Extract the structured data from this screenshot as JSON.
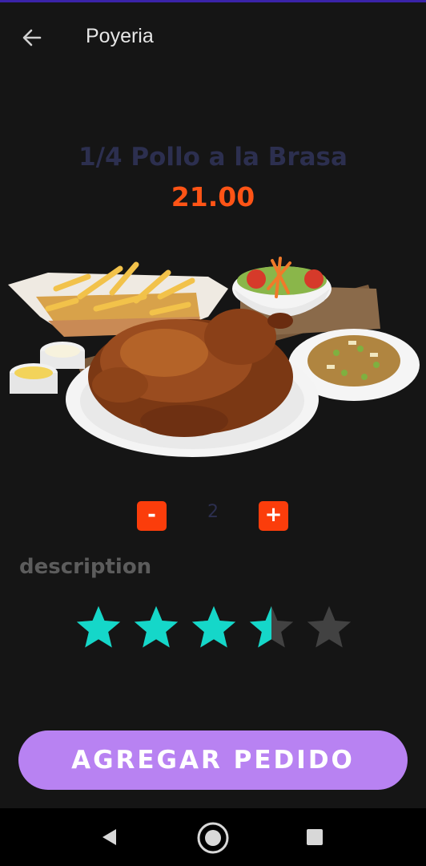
{
  "app_bar": {
    "title": "Poyeria",
    "back_icon": "arrow-left-icon"
  },
  "product": {
    "name": "1/4 Pollo a la Brasa",
    "price": "21.00",
    "image_description": "roast chicken plate with fries, salad, rice and sauces"
  },
  "quantity": {
    "minus_label": "-",
    "value": "2",
    "plus_label": "+"
  },
  "description": {
    "label": "description"
  },
  "rating": {
    "value": 3.5,
    "max": 5,
    "filled_color": "#15d7c9",
    "empty_color": "#424242"
  },
  "cta": {
    "label": "AGREGAR PEDIDO",
    "color": "#b882f2"
  },
  "nav_bar": {
    "back_icon": "triangle-back-icon",
    "home_icon": "circle-home-icon",
    "recent_icon": "square-recents-icon"
  },
  "colors": {
    "background": "#151515",
    "accent": "#fb3d0b",
    "price": "#ff5416",
    "title": "#2c2f4f"
  }
}
